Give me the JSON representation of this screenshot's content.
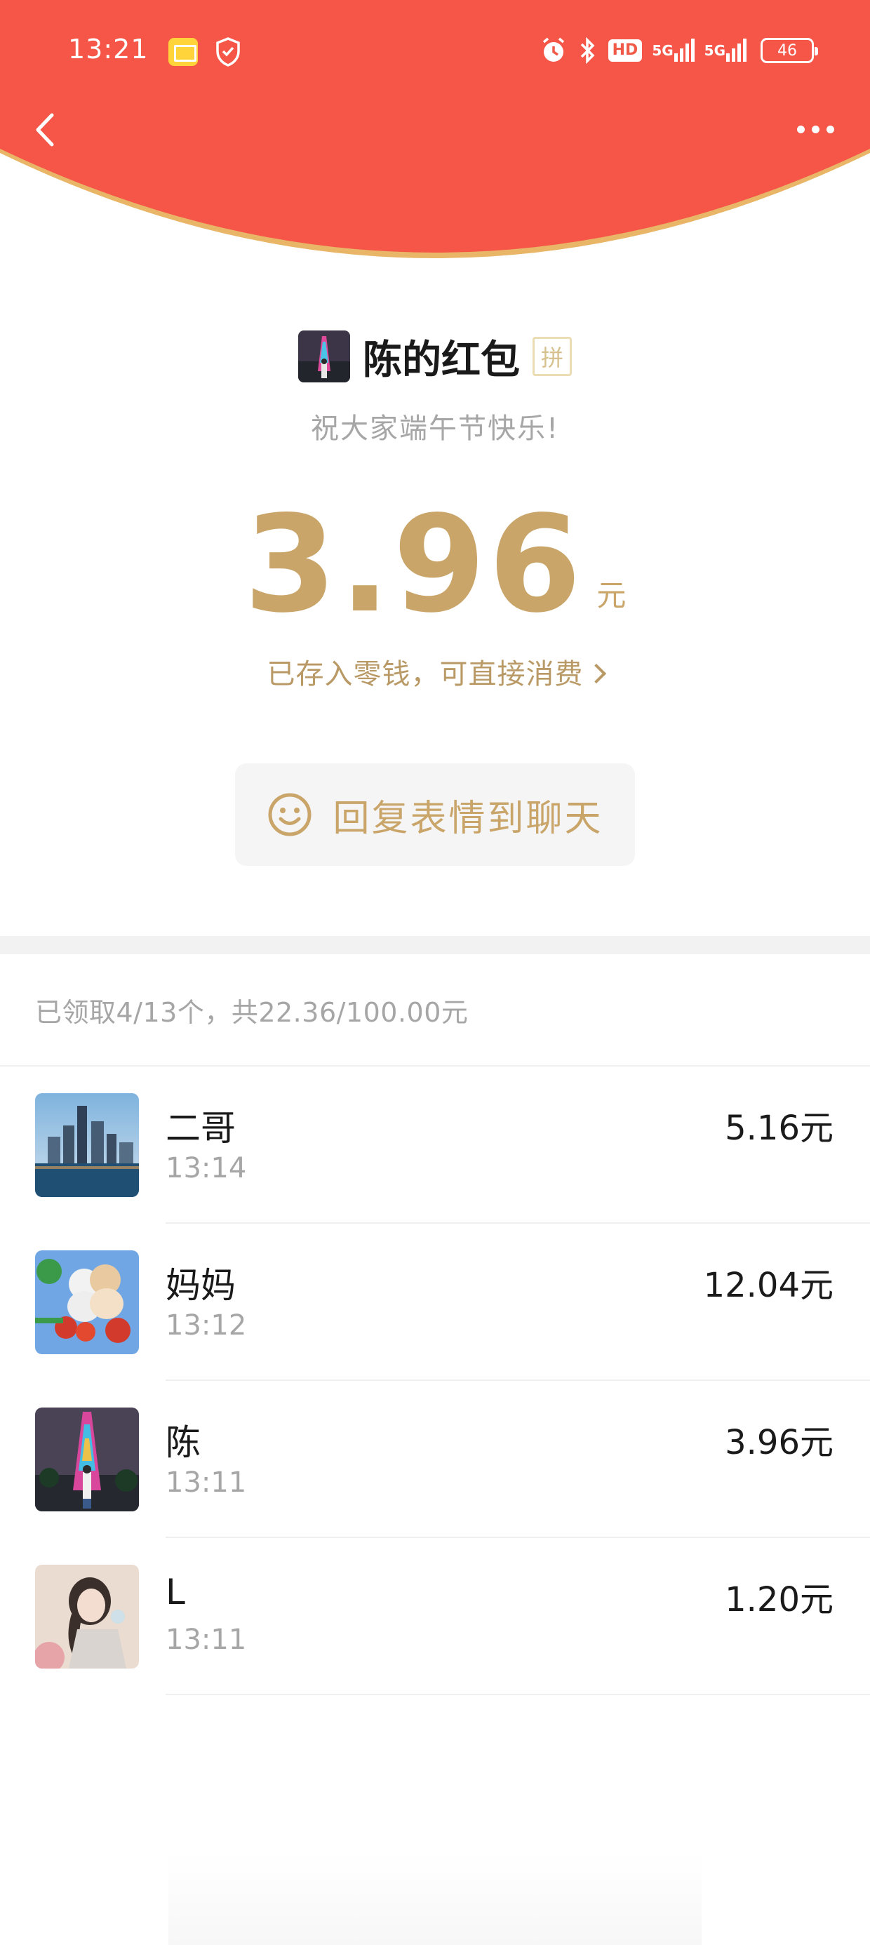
{
  "status_bar": {
    "time": "13:21",
    "hd_label": "HD",
    "signal_1": "5G",
    "signal_2": "5G",
    "battery": "46"
  },
  "colors": {
    "header_red": "#f55648",
    "header_rim": "#e9b668",
    "gold": "#c9a56a",
    "muted_gold": "#b99a66"
  },
  "icons": {
    "back": "chevron-left-icon",
    "more": "more-horizontal-icon",
    "reply": "smiley-icon",
    "stored_arrow": "chevron-right-icon"
  },
  "packet": {
    "sender": "陈的红包",
    "pin_badge": "拼",
    "blessing": "祝大家端午节快乐!",
    "amount": "3.96",
    "unit": "元",
    "stored_note": "已存入零钱，可直接消费",
    "reply_label": "回复表情到聊天"
  },
  "summary": {
    "text": "已领取4/13个，共22.36/100.00元"
  },
  "receivers": [
    {
      "name": "二哥",
      "time": "13:14",
      "amount": "5.16元"
    },
    {
      "name": "妈妈",
      "time": "13:12",
      "amount": "12.04元"
    },
    {
      "name": "陈",
      "time": "13:11",
      "amount": "3.96元"
    },
    {
      "name": "L",
      "time": "13:11",
      "amount": "1.20元"
    }
  ]
}
